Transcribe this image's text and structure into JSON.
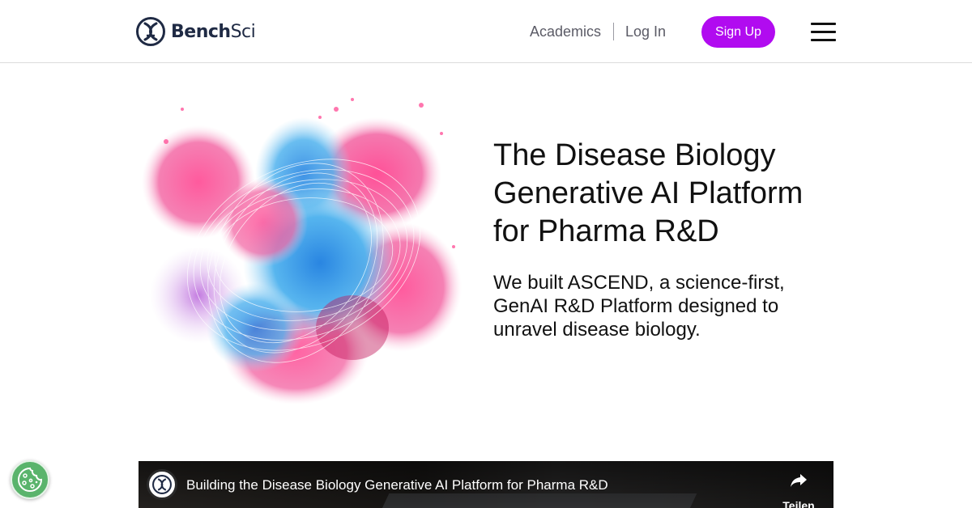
{
  "header": {
    "logo_text_bold": "Bench",
    "logo_text_regular": "Sci",
    "nav": {
      "academics": "Academics",
      "login": "Log In",
      "signup": "Sign Up"
    },
    "menu_icon": "hamburger-menu-icon"
  },
  "hero": {
    "title": "The Disease Biology Generative AI Platform for Pharma R&D",
    "subtitle": "We built ASCEND, a science-first, GenAI R&D Platform designed to unravel disease biology.",
    "art": "ink-splash-illustration"
  },
  "video": {
    "title": "Building the Disease Biology Generative AI Platform for Pharma R&D",
    "share_label": "Teilen",
    "share_icon": "share-arrow-icon",
    "channel_icon": "benchsci-logo-icon"
  },
  "cookie": {
    "icon": "cookie-icon"
  },
  "colors": {
    "brand_purple": "#b10bf0",
    "logo_navy": "#1f2a44",
    "cookie_green": "#5ab46c"
  }
}
